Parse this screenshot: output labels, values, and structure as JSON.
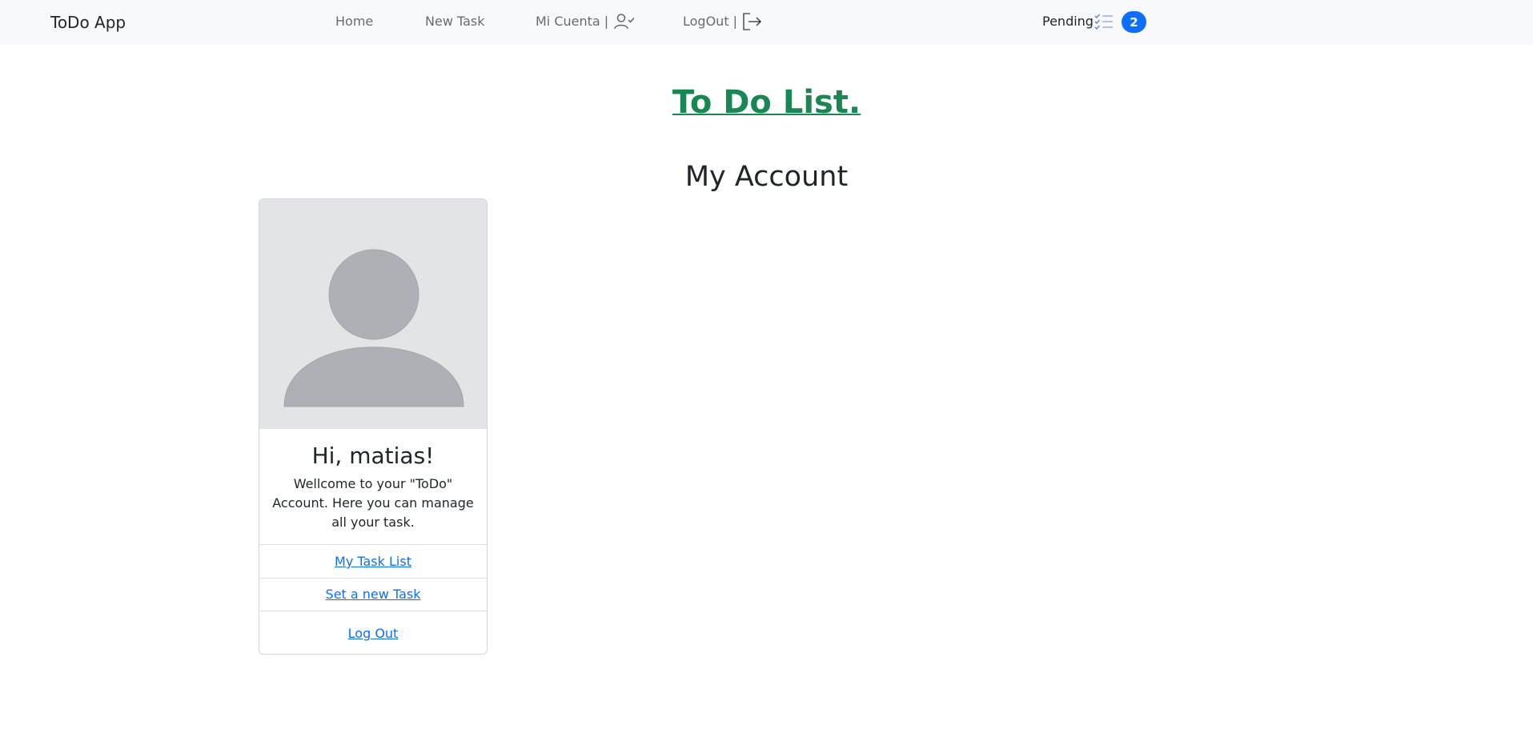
{
  "navbar": {
    "brand": "ToDo App",
    "links": [
      {
        "label": "Home"
      },
      {
        "label": "New Task"
      },
      {
        "label": "Mi Cuenta |",
        "icon": "user-check-icon"
      },
      {
        "label": "LogOut |",
        "icon": "box-arrow-right-icon"
      }
    ],
    "pending": {
      "label": "Pending",
      "icon": "list-check-icon",
      "count": "2"
    }
  },
  "main": {
    "title": "To Do List.",
    "subtitle": "My Account"
  },
  "card": {
    "image_icon": "person-avatar-icon",
    "greeting": "Hi, matias!",
    "text": "Wellcome to your \"ToDo\" Account. Here you can manage all your task.",
    "links": [
      {
        "label": "My Task List"
      },
      {
        "label": "Set a new Task"
      },
      {
        "label": "Log Out"
      }
    ]
  },
  "colors": {
    "navbar_bg": "#f8f9fa",
    "title_green": "#198754",
    "link_blue": "#0d6efd",
    "badge_blue": "#0d6efd"
  }
}
